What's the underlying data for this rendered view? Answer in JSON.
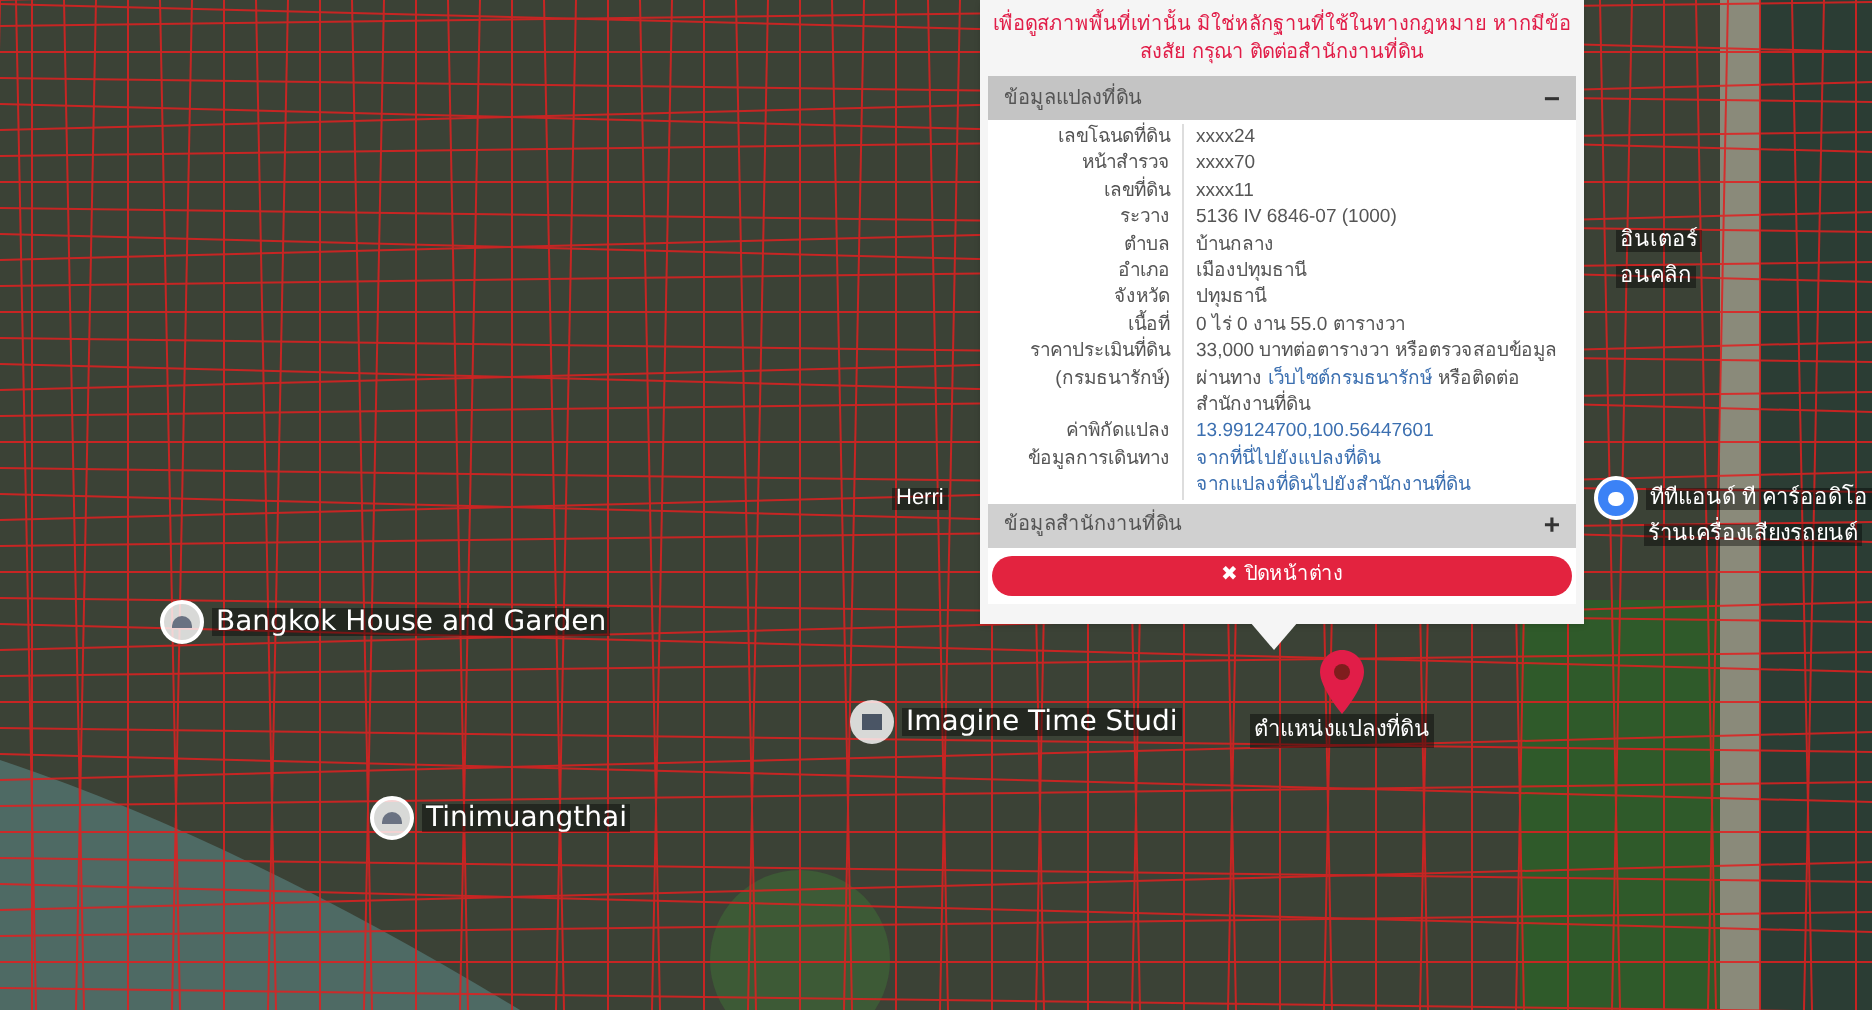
{
  "map": {
    "labels": [
      {
        "text": "อินเตอร์",
        "kind": "text"
      },
      {
        "text": "อนคลิก",
        "kind": "text"
      },
      {
        "text": "Herri",
        "kind": "text"
      },
      {
        "text": "ทีทีแอนด์ ที คาร์ออดิโอ",
        "kind": "lock"
      },
      {
        "text": "ร้านเครื่องเสียงรถยนต์",
        "kind": "text"
      },
      {
        "text": "Bangkok House and Garden",
        "kind": "place"
      },
      {
        "text": "Imagine Time Studi",
        "kind": "school"
      },
      {
        "text": "Tinimuangthai",
        "kind": "place"
      }
    ],
    "marker": {
      "label": "ตำแหน่งแปลงที่ดิน"
    }
  },
  "popup": {
    "notice": "เพื่อดูสภาพพื้นที่เท่านั้น มิใช่หลักฐานที่ใช้ในทางกฎหมาย หากมีข้อสงสัย กรุณา ติดต่อสำนักงานที่ดิน",
    "sections": [
      {
        "title": "ข้อมูลแปลงที่ดิน",
        "toggle": "−",
        "expanded": true,
        "rows": [
          {
            "label": "เลขโฉนดที่ดิน",
            "value": [
              {
                "text": "xxxx24",
                "link": false
              }
            ]
          },
          {
            "label": "หน้าสำรวจ",
            "value": [
              {
                "text": "xxxx70",
                "link": false
              }
            ]
          },
          {
            "label": "เลขที่ดิน",
            "value": [
              {
                "text": "xxxx11",
                "link": false
              }
            ]
          },
          {
            "label": "ระวาง",
            "value": [
              {
                "text": "5136 IV 6846-07 (1000)",
                "link": false
              }
            ]
          },
          {
            "label": "ตำบล",
            "value": [
              {
                "text": "บ้านกลาง",
                "link": false
              }
            ]
          },
          {
            "label": "อำเภอ",
            "value": [
              {
                "text": "เมืองปทุมธานี",
                "link": false
              }
            ]
          },
          {
            "label": "จังหวัด",
            "value": [
              {
                "text": "ปทุมธานี",
                "link": false
              }
            ]
          },
          {
            "label": "เนื้อที่",
            "value": [
              {
                "text": "0 ไร่ 0 งาน 55.0 ตารางวา",
                "link": false
              }
            ]
          },
          {
            "label": "ราคาประเมินที่ดิน (กรมธนารักษ์)",
            "value": [
              {
                "text": "33,000 บาทต่อตารางวา หรือตรวจสอบข้อมูลผ่านทาง",
                "link": false
              },
              {
                "text": "เว็บไซต์กรมธนารักษ์",
                "link": true
              },
              {
                "text": "หรือติดต่อสำนักงานที่ดิน",
                "link": false
              }
            ]
          },
          {
            "label": "ค่าพิกัดแปลง",
            "value": [
              {
                "text": "13.99124700,100.56447601",
                "link": true
              }
            ]
          },
          {
            "label": "ข้อมูลการเดินทาง",
            "value": [
              {
                "text": "จากที่นี่ไปยังแปลงที่ดิน",
                "link": true
              },
              {
                "text": "จากแปลงที่ดินไปยังสำนักงานที่ดิน",
                "link": true
              }
            ]
          }
        ]
      },
      {
        "title": "ข้อมูลสำนักงานที่ดิน",
        "toggle": "+",
        "expanded": false
      }
    ],
    "close_button": {
      "icon": "✖",
      "label": "ปิดหน้าต่าง"
    }
  }
}
